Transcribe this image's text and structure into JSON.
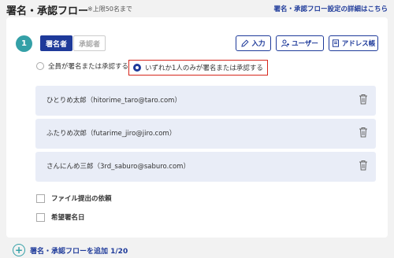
{
  "header": {
    "title": "署名・承認フロー",
    "note": "※上限50名まで",
    "details_link": "署名・承認フロー設定の詳細はこちら"
  },
  "step": {
    "number": "1",
    "tabs": [
      {
        "label": "署名者",
        "active": true
      },
      {
        "label": "承認者",
        "active": false
      }
    ],
    "toolbar": {
      "input_label": "入力",
      "user_label": "ユーザー",
      "address_label": "アドレス帳",
      "input_icon": "pencil-icon",
      "user_icon": "user-add-icon",
      "address_icon": "address-book-icon"
    },
    "options": {
      "all_label": "全員が署名または承認する",
      "any_label": "いずれか1人のみが署名または承認する",
      "selected": "any"
    },
    "people": [
      {
        "name": "ひとりめ太郎（hitorime_taro@taro.com）"
      },
      {
        "name": "ふたりめ次郎（futarime_jiro@jiro.com）"
      },
      {
        "name": "さんにんめ三郎（3rd_saburo@saburo.com）"
      }
    ],
    "checkboxes": {
      "file_request": "ファイル提出の依頼",
      "desired_date": "希望署名日"
    }
  },
  "add": {
    "label": "署名・承認フローを追加 1/20"
  },
  "colors": {
    "accent": "#1e3a9a",
    "teal": "#34a0a7",
    "highlight_red": "#d6261c",
    "person_bg": "#e9edf7"
  }
}
